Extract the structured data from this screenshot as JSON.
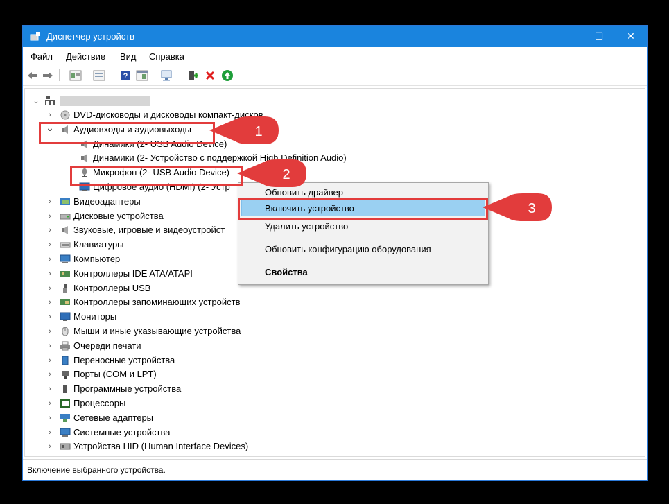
{
  "window": {
    "title": "Диспетчер устройств",
    "controls": {
      "minimize": "—",
      "maximize": "☐",
      "close": "✕"
    }
  },
  "menu": [
    "Файл",
    "Действие",
    "Вид",
    "Справка"
  ],
  "tree": {
    "root_label": "",
    "items": [
      {
        "label": "DVD-дисководы и дисководы компакт-дисков",
        "icon": "dvd-drive-icon",
        "expanded": false
      },
      {
        "label": "Аудиовходы и аудиовыходы",
        "icon": "speaker-icon",
        "expanded": true
      },
      {
        "label": "Динамики (2- USB Audio Device)",
        "icon": "speaker-icon",
        "child": true
      },
      {
        "label": "Динамики (2- Устройство с поддержкой High Definition Audio)",
        "icon": "speaker-icon",
        "child": true
      },
      {
        "label": "Микрофон (2- USB Audio Device)",
        "icon": "microphone-icon",
        "child": true
      },
      {
        "label": "Цифровое аудио (HDMI) (2- Устр",
        "icon": "monitor-icon",
        "child": true
      },
      {
        "label": "Видеоадаптеры",
        "icon": "display-adapter-icon"
      },
      {
        "label": "Дисковые устройства",
        "icon": "disk-icon"
      },
      {
        "label": "Звуковые, игровые и видеоустройст",
        "icon": "sound-icon"
      },
      {
        "label": "Клавиатуры",
        "icon": "keyboard-icon"
      },
      {
        "label": "Компьютер",
        "icon": "computer-icon"
      },
      {
        "label": "Контроллеры IDE ATA/ATAPI",
        "icon": "ide-controller-icon"
      },
      {
        "label": "Контроллеры USB",
        "icon": "usb-icon"
      },
      {
        "label": "Контроллеры запоминающих устройств",
        "icon": "storage-controller-icon"
      },
      {
        "label": "Мониторы",
        "icon": "monitor-icon"
      },
      {
        "label": "Мыши и иные указывающие устройства",
        "icon": "mouse-icon"
      },
      {
        "label": "Очереди печати",
        "icon": "printer-icon"
      },
      {
        "label": "Переносные устройства",
        "icon": "portable-device-icon"
      },
      {
        "label": "Порты (COM и LPT)",
        "icon": "port-icon"
      },
      {
        "label": "Программные устройства",
        "icon": "software-device-icon"
      },
      {
        "label": "Процессоры",
        "icon": "processor-icon"
      },
      {
        "label": "Сетевые адаптеры",
        "icon": "network-adapter-icon"
      },
      {
        "label": "Системные устройства",
        "icon": "system-device-icon"
      },
      {
        "label": "Устройства HID (Human Interface Devices)",
        "icon": "hid-icon"
      }
    ]
  },
  "context_menu": {
    "items": [
      {
        "label": "Обновить драйвер"
      },
      {
        "label": "Включить устройство",
        "highlighted": true
      },
      {
        "label": "Удалить устройство"
      },
      {
        "label": "Обновить конфигурацию оборудования"
      },
      {
        "label": "Свойства",
        "bold": true
      }
    ]
  },
  "callouts": [
    "1",
    "2",
    "3"
  ],
  "status_text": "Включение выбранного устройства.",
  "colors": {
    "titlebar": "#1a84de",
    "callout": "#e23c3c",
    "highlight": "#9ad0f2"
  }
}
